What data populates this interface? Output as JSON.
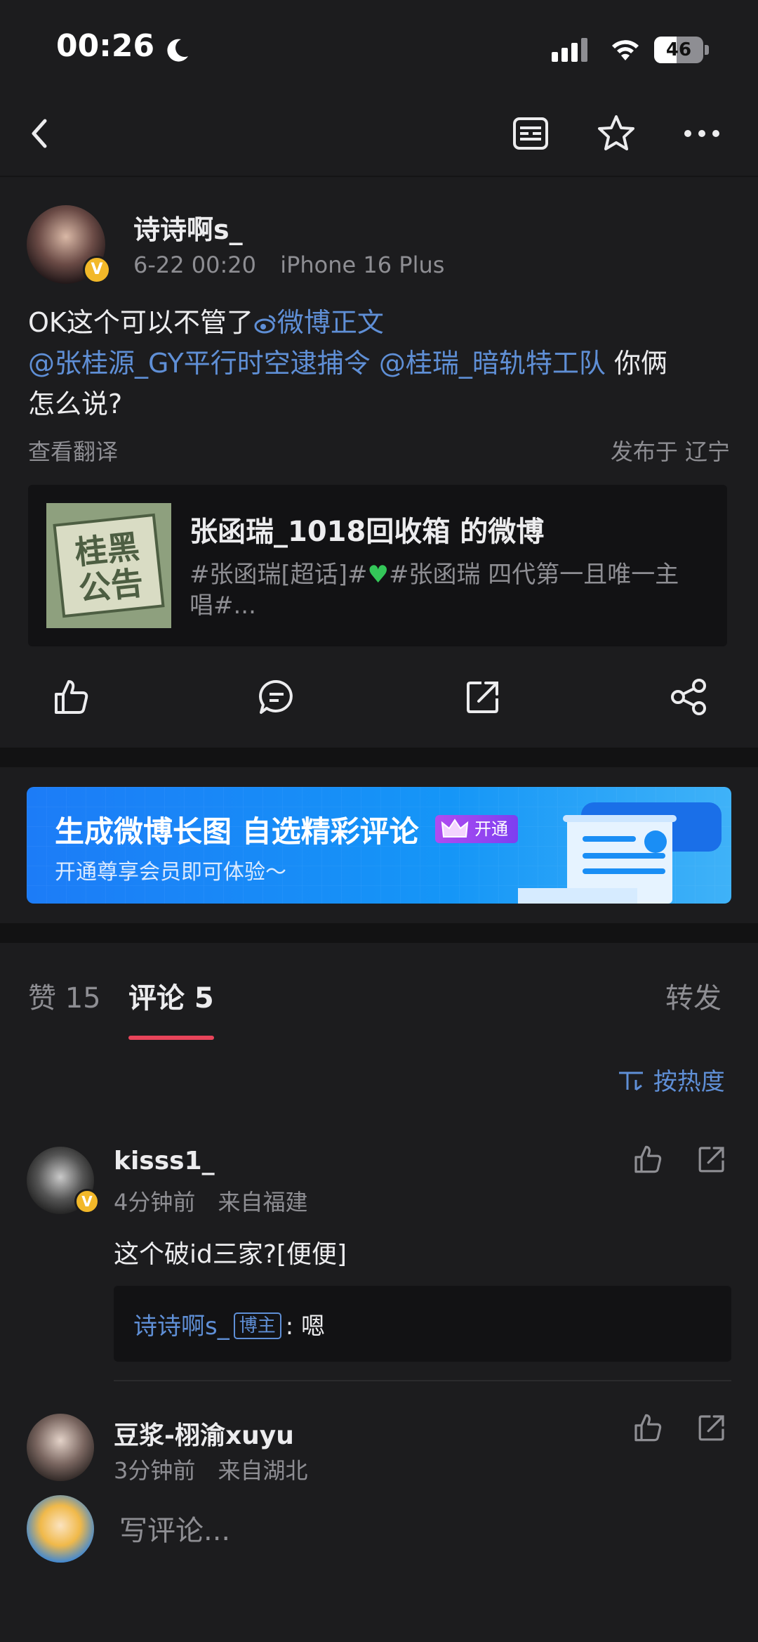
{
  "status_bar": {
    "time": "00:26",
    "battery": "46",
    "battery_level": 0.46
  },
  "post": {
    "author": "诗诗啊s_",
    "date": "6-22 00:20",
    "device": "iPhone 16 Plus",
    "text_plain": "OK这个可以不管了",
    "weibo_link": "微博正文",
    "mention_1": "@张桂源_GY平行时空逮捕令",
    "mention_2": "@桂瑞_暗轨特工队",
    "text_tail_1": " 你俩",
    "text_tail_2": "怎么说?",
    "translate": "查看翻译",
    "location": "发布于 辽宁"
  },
  "quote": {
    "title": "张函瑞_1018回收箱 的微博",
    "desc_1": "#张函瑞[超话]#",
    "desc_2": "#张函瑞 四代第一且唯一主",
    "desc_3": "唱#...",
    "thumb_text": "桂黑公告"
  },
  "banner": {
    "title": "生成微博长图 自选精彩评论",
    "badge": "开通",
    "subtitle": "开通尊享会员即可体验～"
  },
  "tabs": {
    "likes": "赞 15",
    "comments": "评论 5",
    "reposts": "转发"
  },
  "sort": {
    "label": "按热度"
  },
  "comments": [
    {
      "name": "kisss1_",
      "time": "4分钟前",
      "location": "来自福建",
      "text": "这个破id三家?[便便]",
      "reply_author": "诗诗啊s_",
      "reply_tag": "博主",
      "reply_text": ": 嗯"
    },
    {
      "name": "豆浆-栩渝xuyu",
      "time": "3分钟前",
      "location": "来自湖北"
    }
  ],
  "composer": {
    "placeholder": "写评论..."
  },
  "colors": {
    "accent_link": "#5f8fd6",
    "tab_underline": "#e8445a",
    "vip_badge": "#f2b829"
  }
}
